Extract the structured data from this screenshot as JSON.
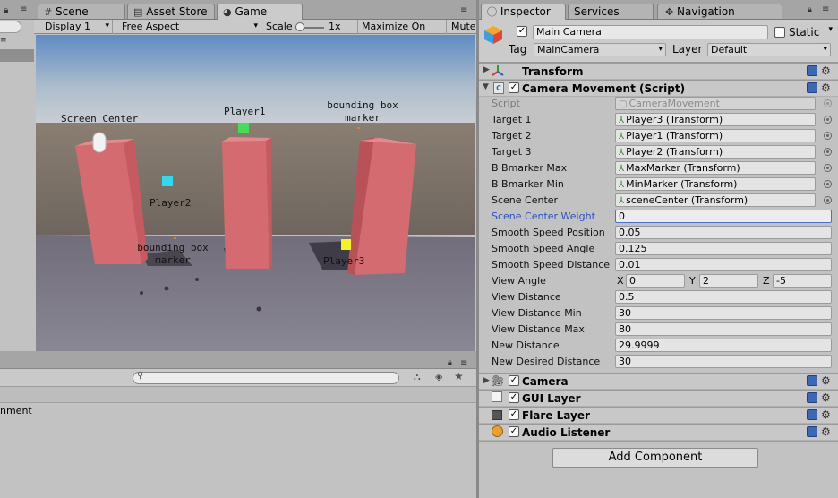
{
  "tabs": {
    "scene": "Scene",
    "asset_store": "Asset Store",
    "game": "Game",
    "inspector": "Inspector",
    "services": "Services",
    "navigation": "Navigation"
  },
  "game_toolbar": {
    "display": "Display 1",
    "aspect": "Free Aspect",
    "scale_label": "Scale",
    "scale_value": "1x",
    "maximize": "Maximize On Play",
    "mute": "Mute"
  },
  "game_view": {
    "labels": {
      "screen_center": "Screen Center",
      "player1": "Player1",
      "player2": "Player2",
      "player3": "Player3",
      "bbox_top_1": "bounding box",
      "bbox_top_2": "marker",
      "bbox_bottom_1": "bounding box",
      "bbox_bottom_2": "marker"
    },
    "colors": {
      "sky_top": "#5d8cc4",
      "sky_bottom": "#c8ced3",
      "ground": "#7c7886",
      "pillar": "#d46b70",
      "player1": "#44dd55",
      "player2": "#30d8f0",
      "player3": "#f4f41a"
    }
  },
  "bottom_panel": {
    "search_placeholder": "",
    "console_text": "nment"
  },
  "inspector": {
    "object_name": "Main Camera",
    "static_label": "Static",
    "tag_label": "Tag",
    "tag_value": "MainCamera",
    "layer_label": "Layer",
    "layer_value": "Default",
    "transform": "Transform",
    "camera_movement": "Camera Movement (Script)",
    "props": [
      {
        "label": "Script",
        "value": "CameraMovement",
        "kind": "ref",
        "disabled": true
      },
      {
        "label": "Target 1",
        "value": "Player3 (Transform)",
        "kind": "ref"
      },
      {
        "label": "Target 2",
        "value": "Player1 (Transform)",
        "kind": "ref"
      },
      {
        "label": "Target 3",
        "value": "Player2 (Transform)",
        "kind": "ref"
      },
      {
        "label": "B Bmarker Max",
        "value": "MaxMarker (Transform)",
        "kind": "ref"
      },
      {
        "label": "B Bmarker Min",
        "value": "MinMarker (Transform)",
        "kind": "ref"
      },
      {
        "label": "Scene Center",
        "value": "sceneCenter (Transform)",
        "kind": "ref"
      },
      {
        "label": "Scene Center Weight",
        "value": "0",
        "kind": "active"
      },
      {
        "label": "Smooth Speed Position",
        "value": "0.05",
        "kind": "plain"
      },
      {
        "label": "Smooth Speed Angle",
        "value": "0.125",
        "kind": "plain"
      },
      {
        "label": "Smooth Speed Distance",
        "value": "0.01",
        "kind": "plain"
      },
      {
        "label": "View Angle",
        "kind": "vector",
        "x": "0",
        "y": "2",
        "z": "-5"
      },
      {
        "label": "View Distance",
        "value": "0.5",
        "kind": "plain"
      },
      {
        "label": "View Distance Min",
        "value": "30",
        "kind": "plain"
      },
      {
        "label": "View Distance Max",
        "value": "80",
        "kind": "plain"
      },
      {
        "label": "New Distance",
        "value": "29.9999",
        "kind": "plain"
      },
      {
        "label": "New Desired Distance",
        "value": "30",
        "kind": "plain"
      }
    ],
    "vec_labels": {
      "x": "X",
      "y": "Y",
      "z": "Z"
    },
    "components": {
      "camera": "Camera",
      "gui_layer": "GUI Layer",
      "flare_layer": "Flare Layer",
      "audio_listener": "Audio Listener"
    },
    "add_component": "Add Component"
  }
}
